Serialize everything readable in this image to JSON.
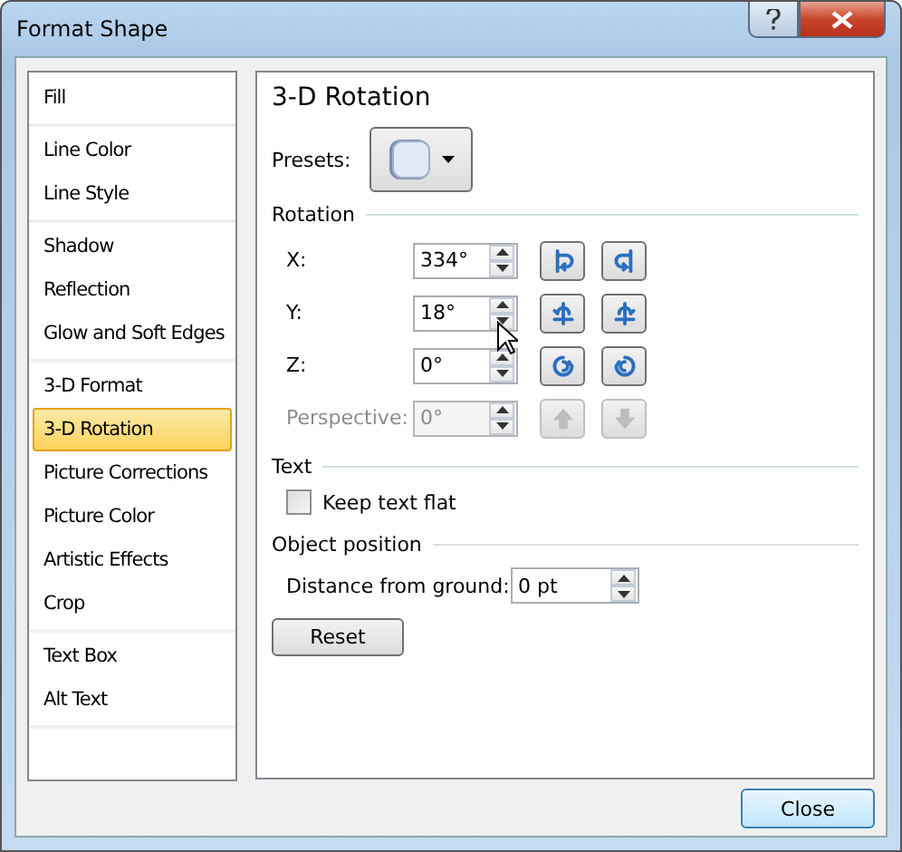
{
  "window": {
    "title": "Format Shape"
  },
  "sidebar": {
    "groups": [
      {
        "items": [
          {
            "label": "Fill",
            "selected": false
          }
        ]
      },
      {
        "items": [
          {
            "label": "Line Color",
            "selected": false
          },
          {
            "label": "Line Style",
            "selected": false
          }
        ]
      },
      {
        "items": [
          {
            "label": "Shadow",
            "selected": false
          },
          {
            "label": "Reflection",
            "selected": false
          },
          {
            "label": "Glow and Soft Edges",
            "selected": false
          }
        ]
      },
      {
        "items": [
          {
            "label": "3-D Format",
            "selected": false
          },
          {
            "label": "3-D Rotation",
            "selected": true
          },
          {
            "label": "Picture Corrections",
            "selected": false
          },
          {
            "label": "Picture Color",
            "selected": false
          },
          {
            "label": "Artistic Effects",
            "selected": false
          },
          {
            "label": "Crop",
            "selected": false
          }
        ]
      },
      {
        "items": [
          {
            "label": "Text Box",
            "selected": false
          },
          {
            "label": "Alt Text",
            "selected": false
          }
        ]
      }
    ]
  },
  "panel": {
    "title": "3-D Rotation",
    "presets": {
      "label": "Presets:"
    },
    "rotation": {
      "heading": "Rotation",
      "axes": [
        {
          "label": "X:",
          "value": "334°",
          "disabled": false
        },
        {
          "label": "Y:",
          "value": "18°",
          "disabled": false
        },
        {
          "label": "Z:",
          "value": "0°",
          "disabled": false
        },
        {
          "label": "Perspective:",
          "value": "0°",
          "disabled": true
        }
      ]
    },
    "text": {
      "heading": "Text",
      "keep_flat": {
        "label": "Keep text flat",
        "checked": false
      }
    },
    "object_position": {
      "heading": "Object position",
      "distance": {
        "label": "Distance from ground:",
        "value": "0 pt"
      }
    },
    "reset_button": "Reset"
  },
  "close_button": "Close"
}
